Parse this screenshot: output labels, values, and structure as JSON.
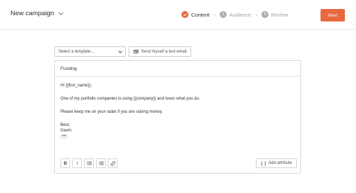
{
  "header": {
    "campaign_title": "New campaign",
    "steps": [
      {
        "number": "1",
        "label": "Content",
        "state": "complete"
      },
      {
        "number": "2",
        "label": "Audience",
        "state": "upcoming"
      },
      {
        "number": "3",
        "label": "Review",
        "state": "upcoming"
      }
    ],
    "next_label": "Next"
  },
  "toolbar": {
    "template_placeholder": "Select a template...",
    "test_email_label": "Send myself a test email"
  },
  "editor": {
    "subject": "Funding",
    "body": {
      "greeting": "Hi {{first_name}},",
      "line1": "One of my portfolio companies is using {{company}} and loves what you do.",
      "line2": "Please keep me on your radar if you are raising money.",
      "signoff": "Best,",
      "name": "Gavin",
      "more": "•••"
    },
    "format": {
      "bold": "B",
      "italic": "I"
    },
    "add_attribute_label": "Add attribute"
  },
  "colors": {
    "accent": "#e8683f",
    "border": "#d4d7db",
    "text": "#2b2f36",
    "muted": "#9aa0a8"
  },
  "icons": {
    "checkmark": "check-icon",
    "mail": "mail-icon",
    "bullet_list": "bullet-list-icon",
    "numbered_list": "numbered-list-icon",
    "link": "link-icon",
    "attribute": "braces-icon"
  }
}
